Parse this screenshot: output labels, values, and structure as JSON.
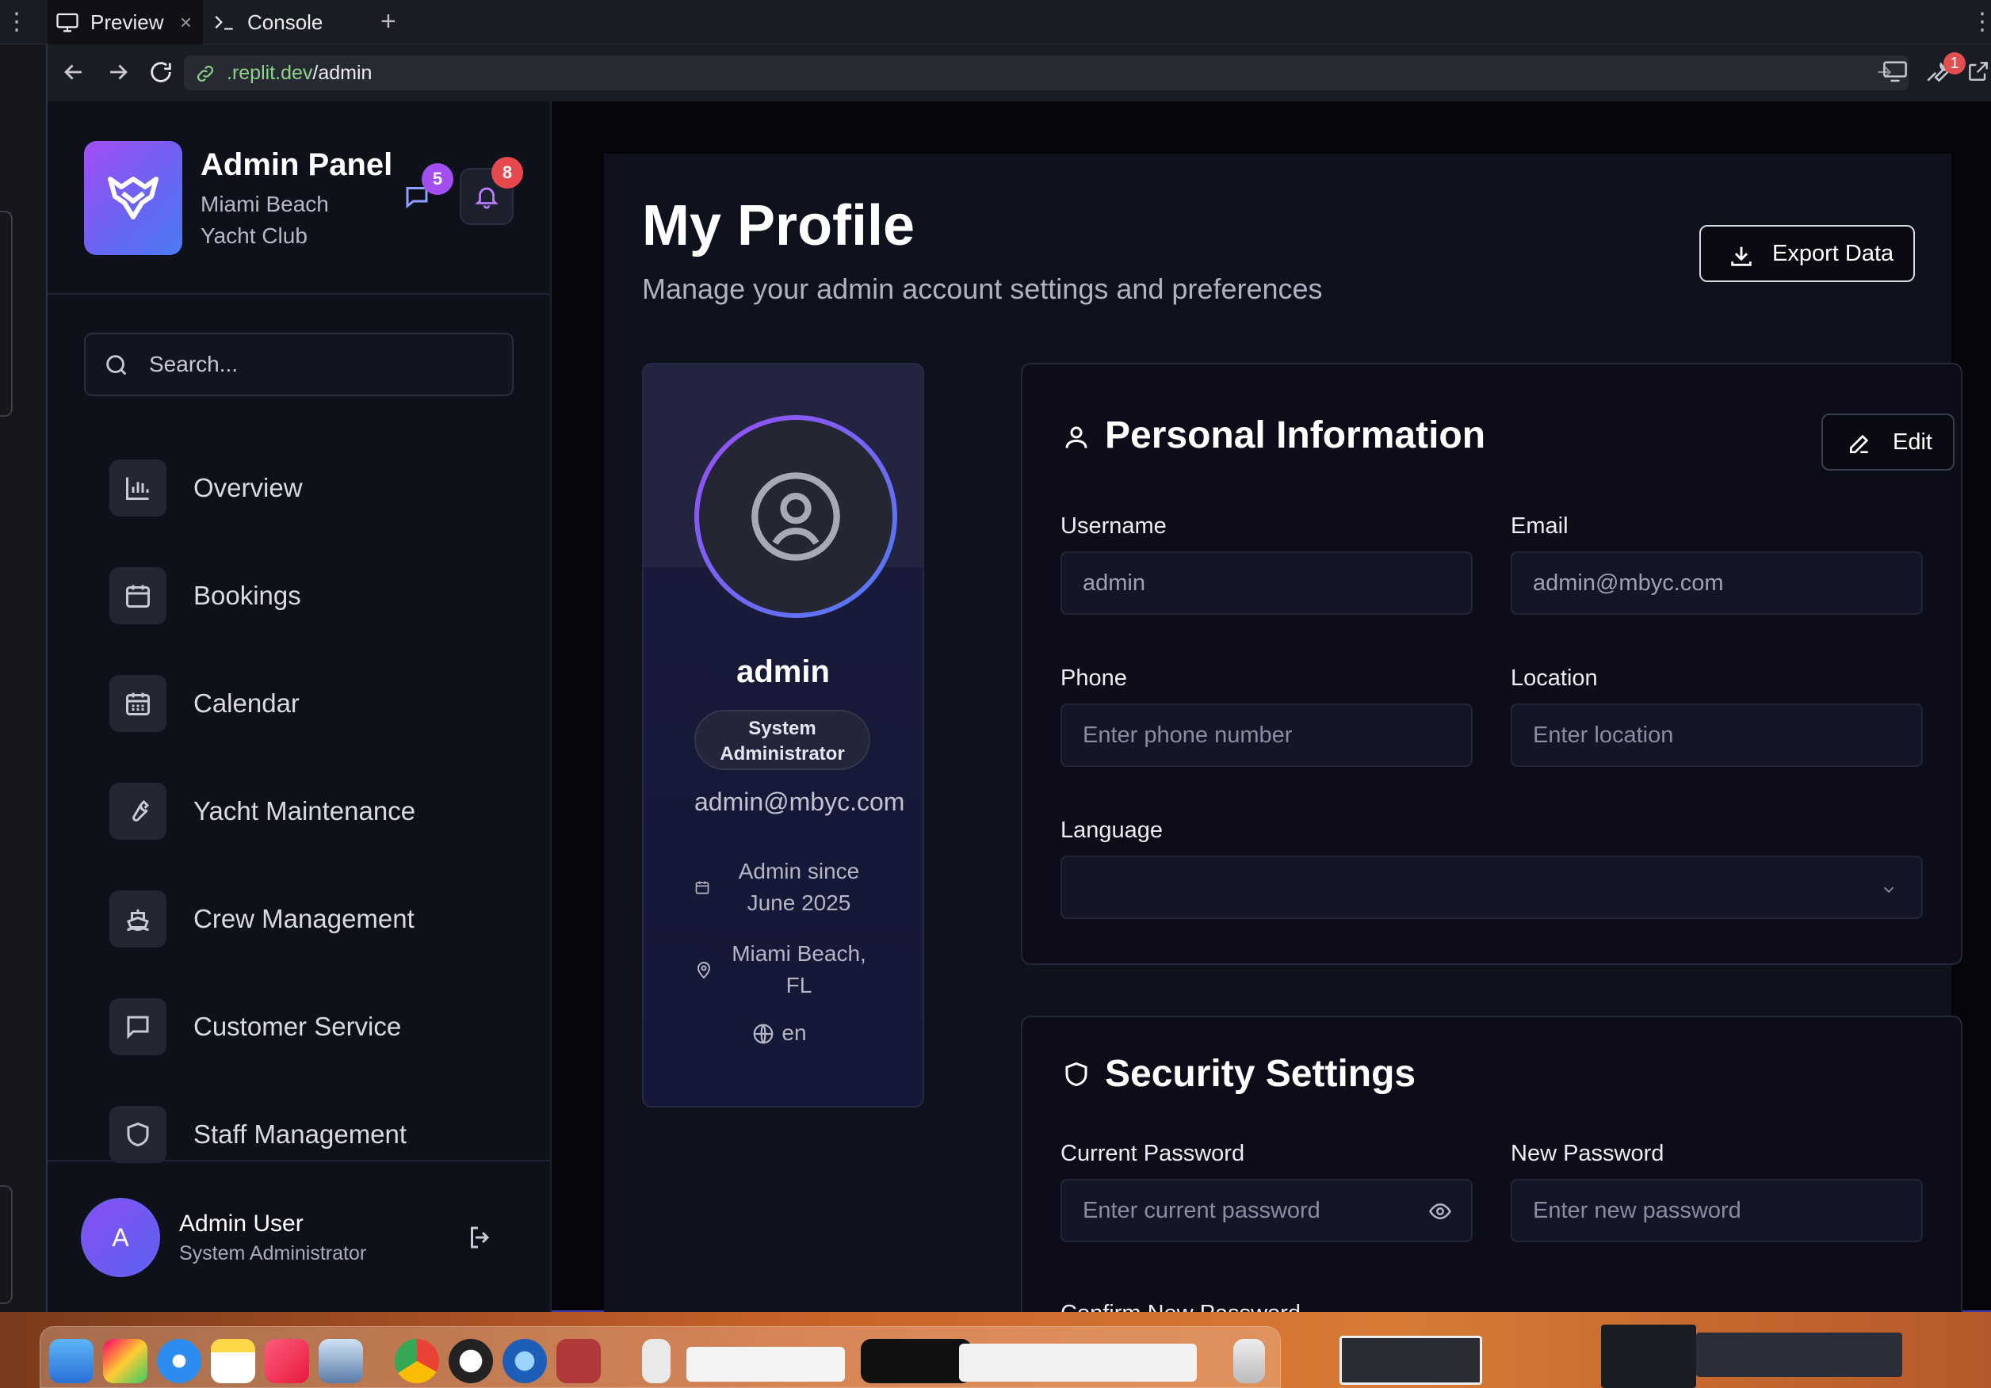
{
  "browser": {
    "tabs": [
      {
        "label": "Preview",
        "icon": "monitor-icon",
        "active": true
      },
      {
        "label": "Console",
        "icon": "terminal-icon",
        "active": false
      }
    ],
    "url_domain": ".replit.dev",
    "url_path": "/admin",
    "devtools_badge": "1"
  },
  "sidebar": {
    "brand_title": "Admin Panel",
    "brand_subtitle": "Miami Beach Yacht Club",
    "messages_badge": "5",
    "notifications_badge": "8",
    "search_placeholder": "Search...",
    "items": [
      {
        "label": "Overview",
        "icon": "bar-chart-icon"
      },
      {
        "label": "Bookings",
        "icon": "calendar-icon"
      },
      {
        "label": "Calendar",
        "icon": "calendar-grid-icon"
      },
      {
        "label": "Yacht Maintenance",
        "icon": "wrench-icon"
      },
      {
        "label": "Crew Management",
        "icon": "ship-icon"
      },
      {
        "label": "Customer Service",
        "icon": "message-icon"
      },
      {
        "label": "Staff Management",
        "icon": "shield-icon"
      }
    ],
    "user": {
      "initial": "A",
      "name": "Admin User",
      "role": "System Administrator"
    }
  },
  "main": {
    "title": "My Profile",
    "subtitle": "Manage your admin account settings and preferences",
    "export_label": "Export Data",
    "profile": {
      "username": "admin",
      "role_line1": "System",
      "role_line2": "Administrator",
      "email": "admin@mbyc.com",
      "since_line1": "Admin since",
      "since_line2": "June 2025",
      "location_line1": "Miami Beach,",
      "location_line2": "FL",
      "language": "en"
    },
    "personal": {
      "title": "Personal Information",
      "edit_label": "Edit",
      "username_label": "Username",
      "username_value": "admin",
      "email_label": "Email",
      "email_value": "admin@mbyc.com",
      "phone_label": "Phone",
      "phone_placeholder": "Enter phone number",
      "location_label": "Location",
      "location_placeholder": "Enter location",
      "language_label": "Language",
      "language_value": ""
    },
    "security": {
      "title": "Security Settings",
      "current_label": "Current Password",
      "current_placeholder": "Enter current password",
      "new_label": "New Password",
      "new_placeholder": "Enter new password",
      "confirm_label": "Confirm New Password"
    }
  },
  "colors": {
    "accent_purple": "#a34ff0",
    "accent_blue": "#4f7cf3",
    "badge_red": "#e5484d",
    "url_green": "#8ed18a"
  }
}
